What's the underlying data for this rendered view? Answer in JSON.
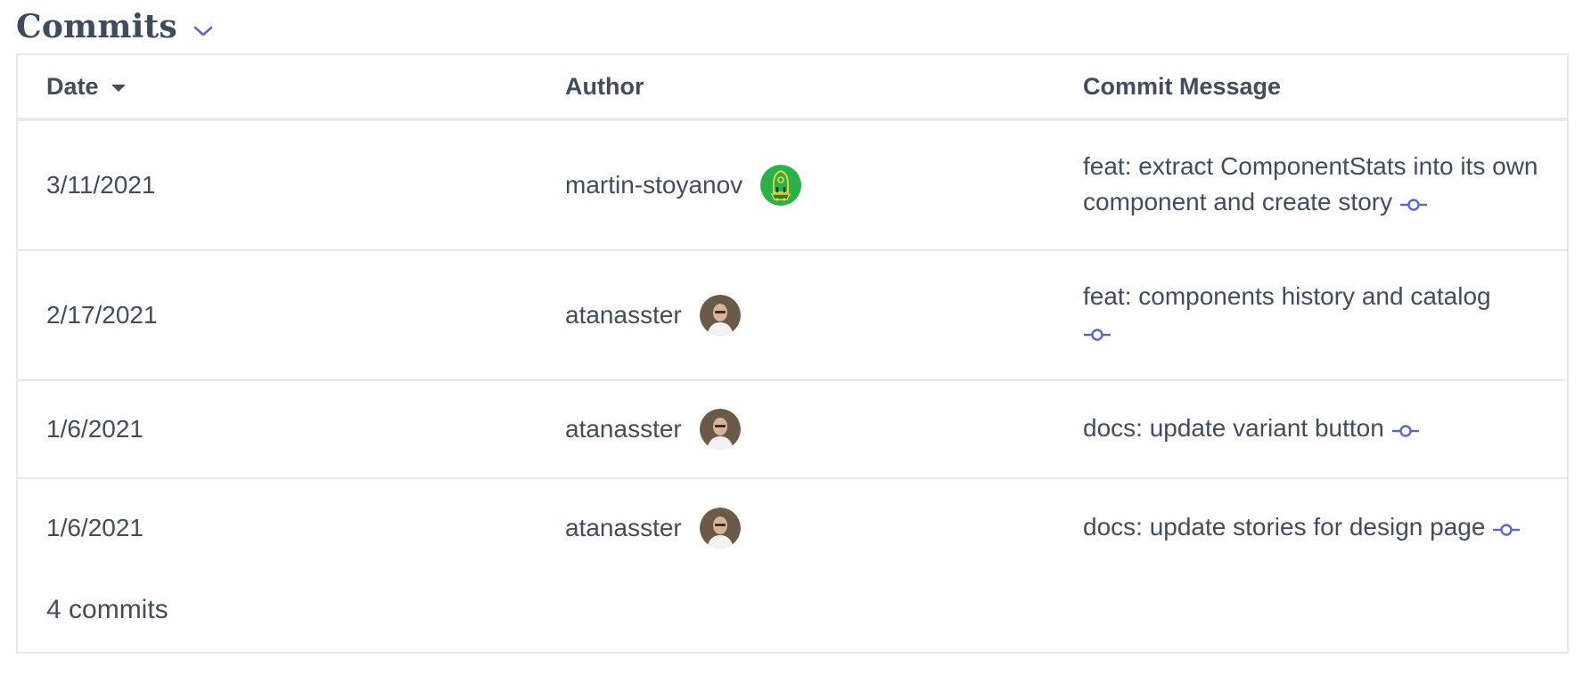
{
  "section": {
    "title": "Commits",
    "toggle_icon": "chevron-down-icon"
  },
  "table": {
    "columns": [
      "Date",
      "Author",
      "Commit Message"
    ],
    "sort_icon": "caret-down-icon",
    "rows": [
      {
        "date": "3/11/2021",
        "author": "martin-stoyanov",
        "avatar": "robot-avatar",
        "message": "feat: extract ComponentStats into its own component and create story",
        "link_icon": "git-commit-icon"
      },
      {
        "date": "2/17/2021",
        "author": "atanasster",
        "avatar": "person-avatar",
        "message": "feat: components history and catalog",
        "link_icon": "git-commit-icon"
      },
      {
        "date": "1/6/2021",
        "author": "atanasster",
        "avatar": "person-avatar",
        "message": "docs: update variant button",
        "link_icon": "git-commit-icon"
      },
      {
        "date": "1/6/2021",
        "author": "atanasster",
        "avatar": "person-avatar",
        "message": "docs: update stories for design page",
        "link_icon": "git-commit-icon"
      }
    ]
  },
  "footer": {
    "count_label": "4 commits"
  },
  "colors": {
    "text": "#414d5c",
    "accent": "#5a67c8",
    "border": "#e6e8eb",
    "robot_avatar_bg": "#2bb14a"
  }
}
